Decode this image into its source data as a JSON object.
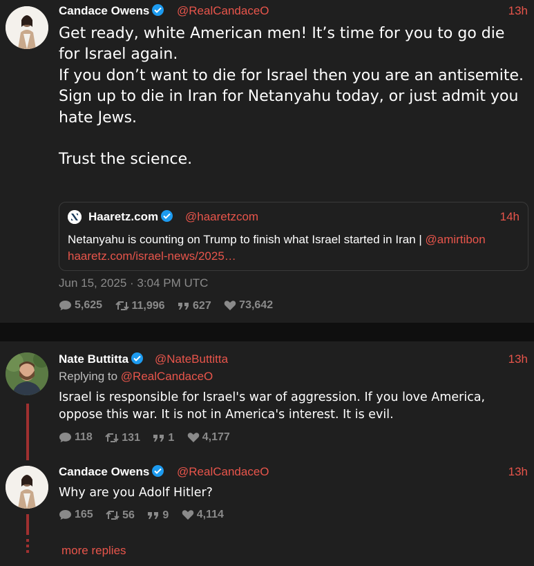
{
  "main_tweet": {
    "name": "Candace Owens",
    "handle": "@RealCandaceO",
    "time": "13h",
    "text": "Get ready, white American men! It’s time for you to go die for Israel again.\nIf you don’t want to die for Israel then you are an antisemite.\nSign up to die in Iran for Netanyahu today, or just admit you hate Jews.\n\nTrust the science.",
    "quote": {
      "name": "Haaretz.com",
      "handle": "@haaretzcom",
      "time": "14h",
      "text": "Netanyahu is counting on Trump to finish what Israel started in Iran | ",
      "mention": "@amirtibon",
      "link": "haaretz.com/israel-news/2025…"
    },
    "date": "Jun 15, 2025 · 3:04 PM UTC",
    "stats": {
      "replies": "5,625",
      "retweets": "11,996",
      "quotes": "627",
      "likes": "73,642"
    }
  },
  "replies": [
    {
      "name": "Nate Buttitta",
      "handle": "@NateButtitta",
      "time": "13h",
      "replying_label": "Replying to ",
      "replying_to": "@RealCandaceO",
      "text": "Israel is responsible for Israel's war of aggression.  If you love America, oppose this war.  It is not in America's interest.  It is evil.",
      "stats": {
        "replies": "118",
        "retweets": "131",
        "quotes": "1",
        "likes": "4,177"
      }
    },
    {
      "name": "Candace Owens",
      "handle": "@RealCandaceO",
      "time": "13h",
      "text": "Why are you Adolf Hitler?",
      "stats": {
        "replies": "165",
        "retweets": "56",
        "quotes": "9",
        "likes": "4,114"
      }
    }
  ],
  "more_replies": "more replies",
  "colors": {
    "accent": "#e8554b",
    "background": "#1f1f1f",
    "verified": "#1d9bf0",
    "muted": "#8a8a8a"
  }
}
